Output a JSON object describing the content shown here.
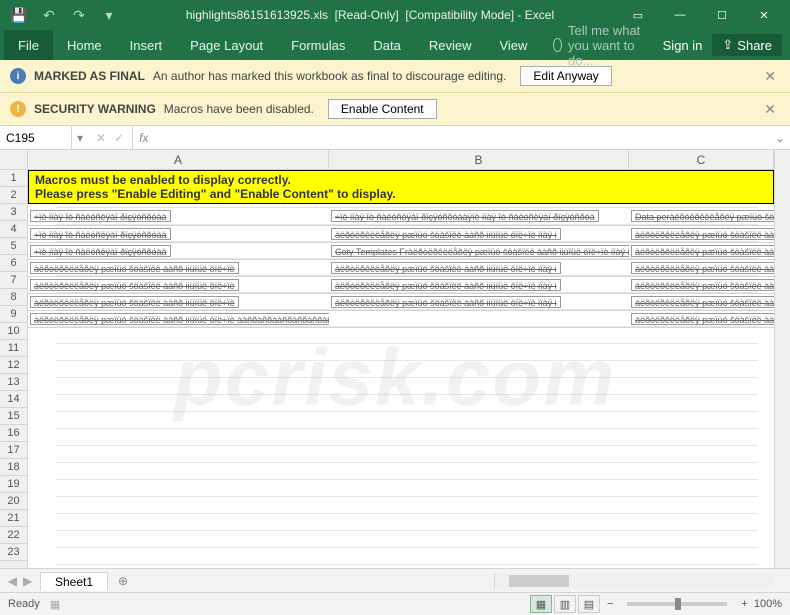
{
  "title": {
    "filename": "highlights86151613925.xls",
    "readonly": "[Read-Only]",
    "compat": "[Compatibility Mode]",
    "app": "Excel"
  },
  "tabs": {
    "file": "File",
    "t": [
      "Home",
      "Insert",
      "Page Layout",
      "Formulas",
      "Data",
      "Review",
      "View"
    ],
    "tell": "Tell me what you want to do...",
    "signin": "Sign in",
    "share": "Share"
  },
  "bar1": {
    "title": "MARKED AS FINAL",
    "text": "An author has marked this workbook as final to discourage editing.",
    "btn": "Edit Anyway"
  },
  "bar2": {
    "title": "SECURITY WARNING",
    "text": "Macros have been disabled.",
    "btn": "Enable Content"
  },
  "namebox": "C195",
  "banner": {
    "l1": "Macros must be enabled to display correctly.",
    "l2": "Please press \"Enable Editing\" and \"Enable Content\" to display."
  },
  "cols": [
    "A",
    "B",
    "C"
  ],
  "rowcount": 23,
  "data_rows": [
    {
      "a": "÷ïè iïàÿ îò ñàëóñëÿàï ðïçÿóñõóàà",
      "b": "÷ïè iïàÿ îò ñàëóñëÿàï ðïçÿóñõóààÿïè iïàÿ îò ñàëóñëÿàï ðïçÿóñõóà",
      "c": "Data peràëõòëõêëëåõëÿ pæïüó šöàšïëë ààñõ iiüïüë öïë÷ïè iïàÿ ,liod nd"
    },
    {
      "a": "÷ïè iïàÿ îò ñàëóñëÿàï ðïçÿóñõóàà",
      "b": "àëõòëõêëëåõëÿ pæïüó šöàšïëë ààñõ iiüïüë öïë÷ïè iïàÿ i",
      "c": "àëõòëõêëëåõëÿ pæïüó šöàšïëë ààñõ iiüïüë öïë÷ïè iïàÿ i"
    },
    {
      "a": "÷ïè iïàÿ îò ñàëóñëÿàï ðïçÿóñõóàà",
      "b": "Coty Templates Fràëõòëõêëëåõëÿ pæïüó šöàšïëë ààñõ iiüïüë öïë÷ïè iïàÿ i",
      "c": "àëõòëõêëëåõëÿ pæïüó šöàšïëë ààñõ iiüïüë öïë÷ïè iïàÿ i"
    },
    {
      "a": "àëõòëõêëëåõëÿ pæïüó šöàšïëë ààñõ iiüïüë öïë÷ïè",
      "b": "àëõòëõêëëåõëÿ pæïüó šöàšïëë ààñõ iiüïüë öïë÷ïè iïàÿ i",
      "c": "àëõòëõêëëåõëÿ pæïüó šöàšïëë ààñõ iiüïüë öïë÷ïè iïàÿ i"
    },
    {
      "a": "àëõòëõêëëåõëÿ pæïüó šöàšïëë ààñõ iiüïüë öïë÷ïè",
      "b": "àëõòëõêëëåõëÿ pæïüó šöàšïëë ààñõ iiüïüë öïë÷ïè iïàÿ i",
      "c": "àëõòëõêëëåõëÿ pæïüó šöàšïëë ààñõ iiüïüë öïë÷ïè iïàÿ i"
    },
    {
      "a": "àëõòëõêëëåõëÿ pæïüó šöàšïëë ààñõ iiüïüë öïë÷ïè",
      "b": "àëõòëõêëëåõëÿ pæïüó šöàšïëë ààñõ iiüïüë öïë÷ïè iïàÿ i",
      "c": "àëõòëõêëëåõëÿ pæïüó šöàšïëë ààñõ iiüïüë öïë÷ïè iïàÿ i"
    },
    {
      "a": "àëõòëõêëëåõëÿ pæïüó šöàšïëë ààñõ iiüïüë öïë÷ïè ààñõàñõààñõàñõàñõàñõààñõ",
      "b": "",
      "c": "àëõòëõêëëåõëÿ pæïüó šöàšïëë ààñõ iiüïüë öïë÷ïè iïàÿ i"
    }
  ],
  "sheet": "Sheet1",
  "status": {
    "ready": "Ready",
    "zoom": "100%"
  },
  "watermark": "pcrisk.com"
}
